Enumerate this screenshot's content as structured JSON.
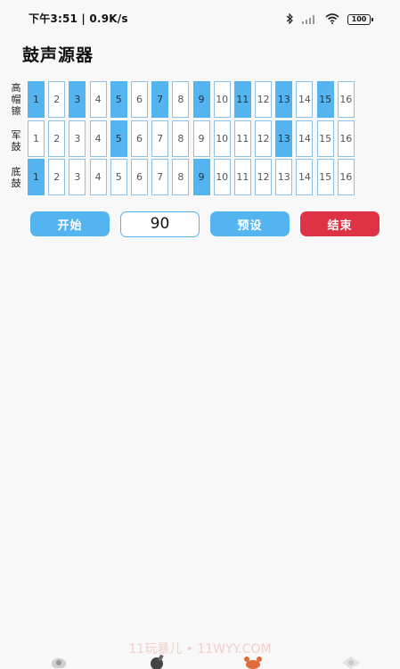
{
  "status_bar": {
    "time": "下午3:51 | 0.9K/s",
    "battery": "100",
    "icons": [
      "bluetooth-icon",
      "signal-icon",
      "wifi-icon",
      "battery-icon"
    ]
  },
  "app": {
    "title": "鼓声源器"
  },
  "tracks": [
    {
      "name": "高帽镲",
      "active_steps": [
        1,
        3,
        5,
        7,
        9,
        11,
        13,
        15
      ]
    },
    {
      "name": "军鼓",
      "active_steps": [
        5,
        13
      ]
    },
    {
      "name": "底鼓",
      "active_steps": [
        1,
        9
      ]
    }
  ],
  "steps": [
    "1",
    "2",
    "3",
    "4",
    "5",
    "6",
    "7",
    "8",
    "9",
    "10",
    "11",
    "12",
    "13",
    "14",
    "15",
    "16"
  ],
  "controls": {
    "start_label": "开始",
    "tempo_value": "90",
    "preset_label": "预设",
    "stop_label": "结束"
  },
  "colors": {
    "accent": "#54b4f0",
    "stop": "#dd3345",
    "cell_border": "#8fc0e6"
  },
  "watermark": "11玩暴儿 • 11WYY.COM",
  "bottom_nav_icons": [
    "home-icon",
    "game-icon",
    "crab-icon",
    "gift-icon"
  ]
}
